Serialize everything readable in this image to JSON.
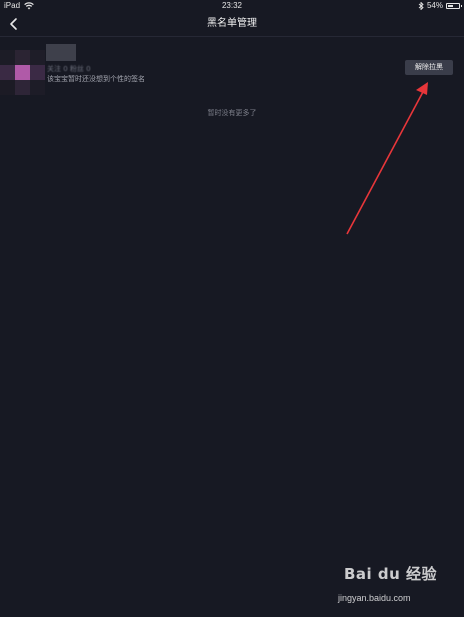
{
  "status_bar": {
    "device": "iPad",
    "time": "23:32",
    "battery": "54%",
    "battery_level": 0.54
  },
  "nav": {
    "title": "黑名单管理"
  },
  "blocked_users": [
    {
      "stats": "关注 0  粉丝 0",
      "signature": "该宝宝暂时还没想到个性的签名",
      "unblock_label": "解除拉黑"
    }
  ],
  "list_end_text": "暂时没有更多了",
  "annotation": {
    "arrow_color": "#e8363a"
  },
  "watermark": {
    "logo": "Bai du 经验",
    "url": "jingyan.baidu.com"
  },
  "colors": {
    "background": "#171923",
    "button": "#3a3d4a",
    "avatar_accent": "#b05aa8"
  }
}
